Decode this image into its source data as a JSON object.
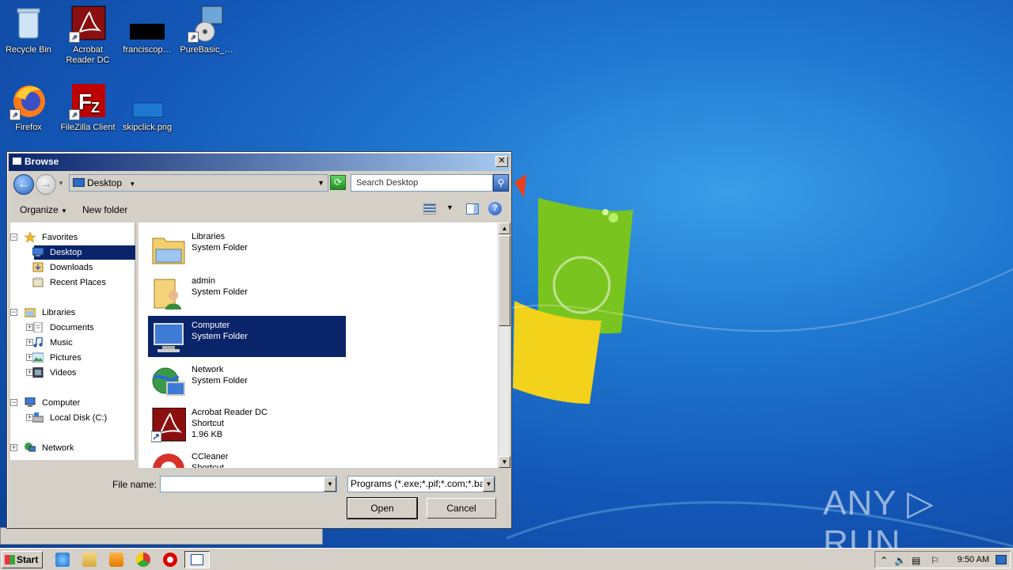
{
  "desktop": {
    "icons": [
      {
        "label": "Recycle Bin",
        "icon": "recycle-bin-icon"
      },
      {
        "label": "Acrobat Reader DC",
        "icon": "acrobat-icon"
      },
      {
        "label": "franciscop…",
        "icon": "black-file-icon"
      },
      {
        "label": "PureBasic_…",
        "icon": "installer-icon"
      },
      {
        "label": "Firefox",
        "icon": "firefox-icon"
      },
      {
        "label": "FileZilla Client",
        "icon": "filezilla-icon"
      },
      {
        "label": "skipclick.png",
        "icon": "image-file-icon"
      }
    ],
    "watermark": "ANY ▷ RUN"
  },
  "dialog": {
    "title": "Browse",
    "address": "Desktop",
    "search_placeholder": "Search Desktop",
    "toolbar": {
      "organize": "Organize",
      "new_folder": "New folder"
    },
    "tree": {
      "favorites": "Favorites",
      "desktop": "Desktop",
      "downloads": "Downloads",
      "recent": "Recent Places",
      "libraries": "Libraries",
      "documents": "Documents",
      "music": "Music",
      "pictures": "Pictures",
      "videos": "Videos",
      "computer": "Computer",
      "local_disk": "Local Disk (C:)",
      "network": "Network"
    },
    "files": [
      {
        "name": "Libraries",
        "type": "System Folder"
      },
      {
        "name": "admin",
        "type": "System Folder"
      },
      {
        "name": "Computer",
        "type": "System Folder"
      },
      {
        "name": "Network",
        "type": "System Folder"
      },
      {
        "name": "Acrobat Reader DC",
        "type": "Shortcut",
        "size": "1.96 KB"
      },
      {
        "name": "CCleaner",
        "type": "Shortcut"
      }
    ],
    "file_name_label": "File name:",
    "file_name_value": "",
    "filter": "Programs (*.exe;*.pif;*.com;*.bat",
    "open": "Open",
    "cancel": "Cancel"
  },
  "taskbar": {
    "start": "Start",
    "clock": "9:50 AM"
  },
  "colors": {
    "selection": "#0a246a",
    "desktop": "#1f78d0",
    "chrome": "#d4d0c8"
  }
}
